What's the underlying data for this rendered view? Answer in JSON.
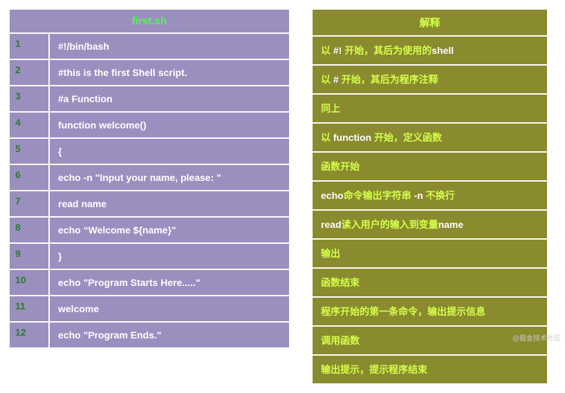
{
  "left": {
    "title": "first.sh",
    "rows": [
      {
        "n": "1",
        "code": "#!/bin/bash"
      },
      {
        "n": "2",
        "code": "#this is the first Shell script."
      },
      {
        "n": "3",
        "code": "#a Function"
      },
      {
        "n": "4",
        "code": "function welcome()"
      },
      {
        "n": "5",
        "code": "{"
      },
      {
        "n": "6",
        "code": "echo -n \"Input your name, please: \""
      },
      {
        "n": "7",
        "code": "read name"
      },
      {
        "n": "8",
        "code": "echo “Welcome ${name}\""
      },
      {
        "n": "9",
        "code": "}"
      },
      {
        "n": "10",
        "code": "echo \"Program Starts Here.....\""
      },
      {
        "n": "11",
        "code": "welcome"
      },
      {
        "n": "12",
        "code": "echo \"Program Ends.\""
      }
    ]
  },
  "right": {
    "title": "解释",
    "rows": [
      {
        "segments": [
          {
            "t": "以 "
          },
          {
            "t": "#!",
            "hl": true
          },
          {
            "t": "  开始，其后为使用的"
          },
          {
            "t": "shell",
            "hl": true
          }
        ]
      },
      {
        "segments": [
          {
            "t": "以 "
          },
          {
            "t": "#",
            "hl": true
          },
          {
            "t": "  开始，其后为程序注释"
          }
        ]
      },
      {
        "segments": [
          {
            "t": "同上"
          }
        ]
      },
      {
        "segments": [
          {
            "t": "以 "
          },
          {
            "t": "function",
            "hl": true
          },
          {
            "t": " 开始，定义函数"
          }
        ]
      },
      {
        "segments": [
          {
            "t": "函数开始"
          }
        ]
      },
      {
        "segments": [
          {
            "t": "echo",
            "hl": true
          },
          {
            "t": "命令输出字符串 "
          },
          {
            "t": "-n",
            "hl": true
          },
          {
            "t": "  不换行"
          }
        ]
      },
      {
        "segments": [
          {
            "t": "read",
            "hl": true
          },
          {
            "t": "读入用户的输入到变量"
          },
          {
            "t": "name",
            "hl": true
          }
        ]
      },
      {
        "segments": [
          {
            "t": "输出"
          }
        ]
      },
      {
        "segments": [
          {
            "t": "函数结束"
          }
        ]
      },
      {
        "segments": [
          {
            "t": "程序开始的第一条命令，输出提示信息"
          }
        ]
      },
      {
        "segments": [
          {
            "t": "调用函数"
          }
        ]
      },
      {
        "segments": [
          {
            "t": "输出提示，提示程序结束"
          }
        ]
      }
    ]
  },
  "watermark": "@掘金技术社区"
}
